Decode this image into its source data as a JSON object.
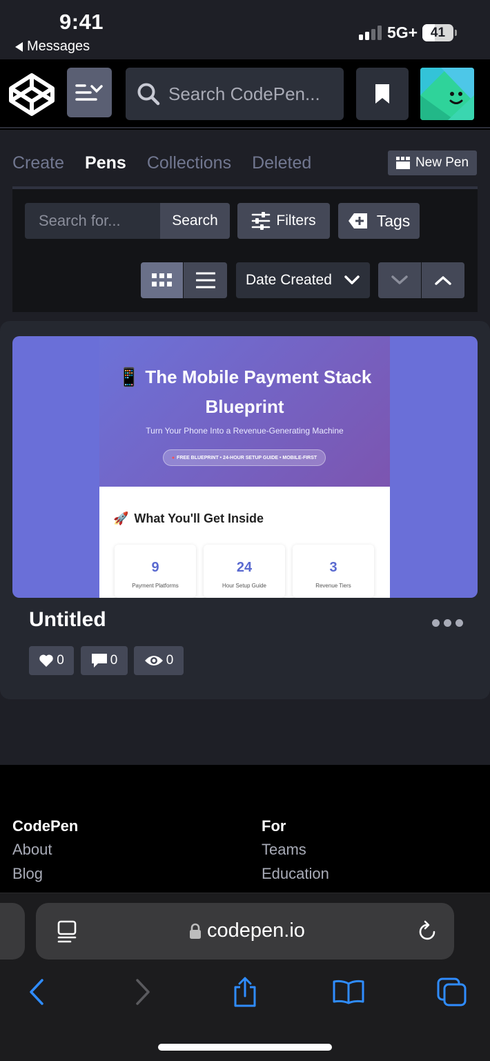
{
  "status_bar": {
    "time": "9:41",
    "back_app": "Messages",
    "network": "5G+",
    "battery": "41",
    "battery_level": 0.41
  },
  "header": {
    "search_placeholder": "Search CodePen...",
    "icons": [
      "codepen-logo-icon",
      "menu-icon",
      "search-icon",
      "bookmark-icon",
      "avatar"
    ]
  },
  "tabs": [
    {
      "label": "Create",
      "active": false
    },
    {
      "label": "Pens",
      "active": true
    },
    {
      "label": "Collections",
      "active": false
    },
    {
      "label": "Deleted",
      "active": false
    }
  ],
  "new_pen_label": "New Pen",
  "filters": {
    "search_placeholder": "Search for...",
    "search_button": "Search",
    "filters_button": "Filters",
    "tags_button": "Tags",
    "sort_value": "Date Created",
    "view_mode": "grid"
  },
  "pen": {
    "title": "Untitled",
    "likes": "0",
    "comments": "0",
    "views": "0",
    "preview": {
      "emoji": "📱",
      "title": "The Mobile Payment Stack Blueprint",
      "subtitle": "Turn Your Phone Into a Revenue-Generating Machine",
      "badge": "FREE BLUEPRINT • 24-HOUR SETUP GUIDE • MOBILE-FIRST",
      "section_emoji": "🚀",
      "section_title": "What You'll Get Inside",
      "stats": [
        {
          "value": "9",
          "label": "Payment Platforms"
        },
        {
          "value": "24",
          "label": "Hour Setup Guide"
        },
        {
          "value": "3",
          "label": "Revenue Tiers"
        }
      ]
    }
  },
  "footer": {
    "col1": {
      "heading": "CodePen",
      "links": [
        "About",
        "Blog"
      ]
    },
    "col2": {
      "heading": "For",
      "links": [
        "Teams",
        "Education"
      ]
    }
  },
  "safari": {
    "url": "codepen.io"
  },
  "colors": {
    "accent": "#5a5f73",
    "link_blue": "#2f8cff",
    "preview_purple": "#6a6fd8"
  }
}
